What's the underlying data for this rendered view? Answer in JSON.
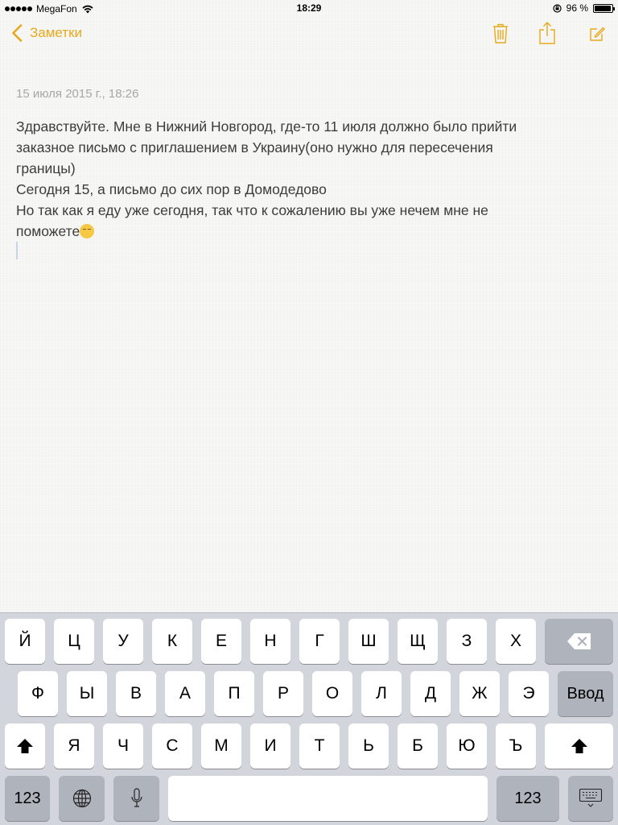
{
  "status_bar": {
    "carrier": "MegaFon",
    "time": "18:29",
    "battery_text": "96 %",
    "battery_level": 0.96
  },
  "nav": {
    "back_label": "Заметки",
    "accent_color": "#e7a91b",
    "icons": [
      "trash-icon",
      "share-icon",
      "compose-icon"
    ]
  },
  "note": {
    "date": "15 июля 2015 г., 18:26",
    "lines": [
      "Здравствуйте. Мне в Нижний Новгород, где-то 11 июля должно было прийти",
      "заказное письмо с приглашением в Украину(оно нужно для пересечения",
      "границы)",
      "Сегодня 15, а письмо до сих пор в Домодедово",
      "Но так как я еду уже сегодня, так что к сожалению вы уже нечем мне не",
      "поможете"
    ],
    "trailing_emoji": "pensive-face-emoji"
  },
  "keyboard": {
    "row1": [
      "Й",
      "Ц",
      "У",
      "К",
      "Е",
      "Н",
      "Г",
      "Ш",
      "Щ",
      "З",
      "Х"
    ],
    "row2": [
      "Ф",
      "Ы",
      "В",
      "А",
      "П",
      "Р",
      "О",
      "Л",
      "Д",
      "Ж",
      "Э"
    ],
    "row3": [
      "Я",
      "Ч",
      "С",
      "М",
      "И",
      "Т",
      "Ь",
      "Б",
      "Ю",
      "Ъ"
    ],
    "return_label": "Ввод",
    "numbers_label": "123"
  }
}
